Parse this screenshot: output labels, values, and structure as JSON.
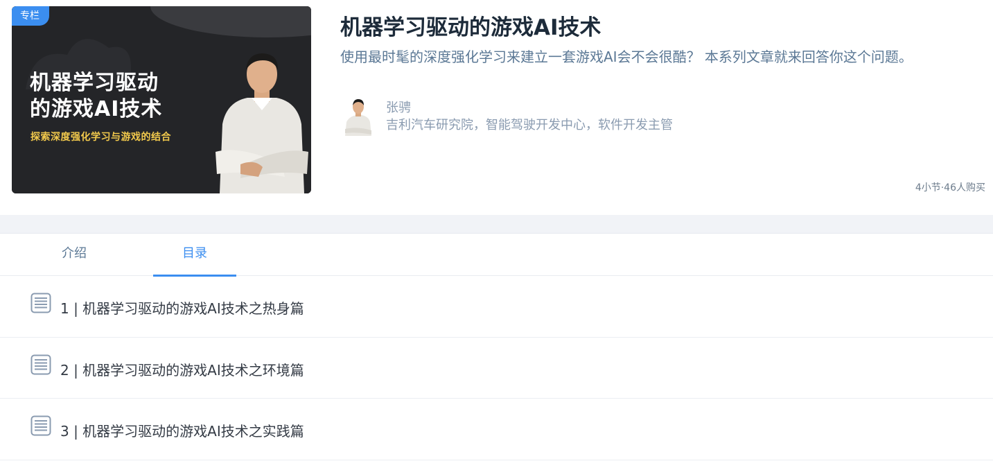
{
  "cover": {
    "tag": "专栏",
    "title_line1": "机器学习驱动",
    "title_line2": "的游戏AI技术",
    "subtitle": "探索深度强化学习与游戏的结合"
  },
  "course": {
    "title": "机器学习驱动的游戏AI技术",
    "description": "使用最时髦的深度强化学习来建立一套游戏AI会不会很酷？ 本系列文章就来回答你这个问题。",
    "stats": "4小节·46人购买"
  },
  "author": {
    "name": "张骋",
    "title": "吉利汽车研究院，智能驾驶开发中心，软件开发主管"
  },
  "tabs": [
    {
      "label": "介绍",
      "active": false
    },
    {
      "label": "目录",
      "active": true
    }
  ],
  "chapters": [
    {
      "label": "1 | 机器学习驱动的游戏AI技术之热身篇"
    },
    {
      "label": "2 | 机器学习驱动的游戏AI技术之环境篇"
    },
    {
      "label": "3 | 机器学习驱动的游戏AI技术之实践篇"
    }
  ],
  "colors": {
    "accent": "#3b8ef0",
    "title": "#1d2b3a",
    "muted": "#8a9bb0",
    "cover_bg": "#222326",
    "cover_subtitle": "#f2c94c"
  },
  "icons": {
    "chapter": "document-list-icon",
    "cover_photo": "person-photo-icon",
    "avatar": "author-avatar-icon"
  }
}
